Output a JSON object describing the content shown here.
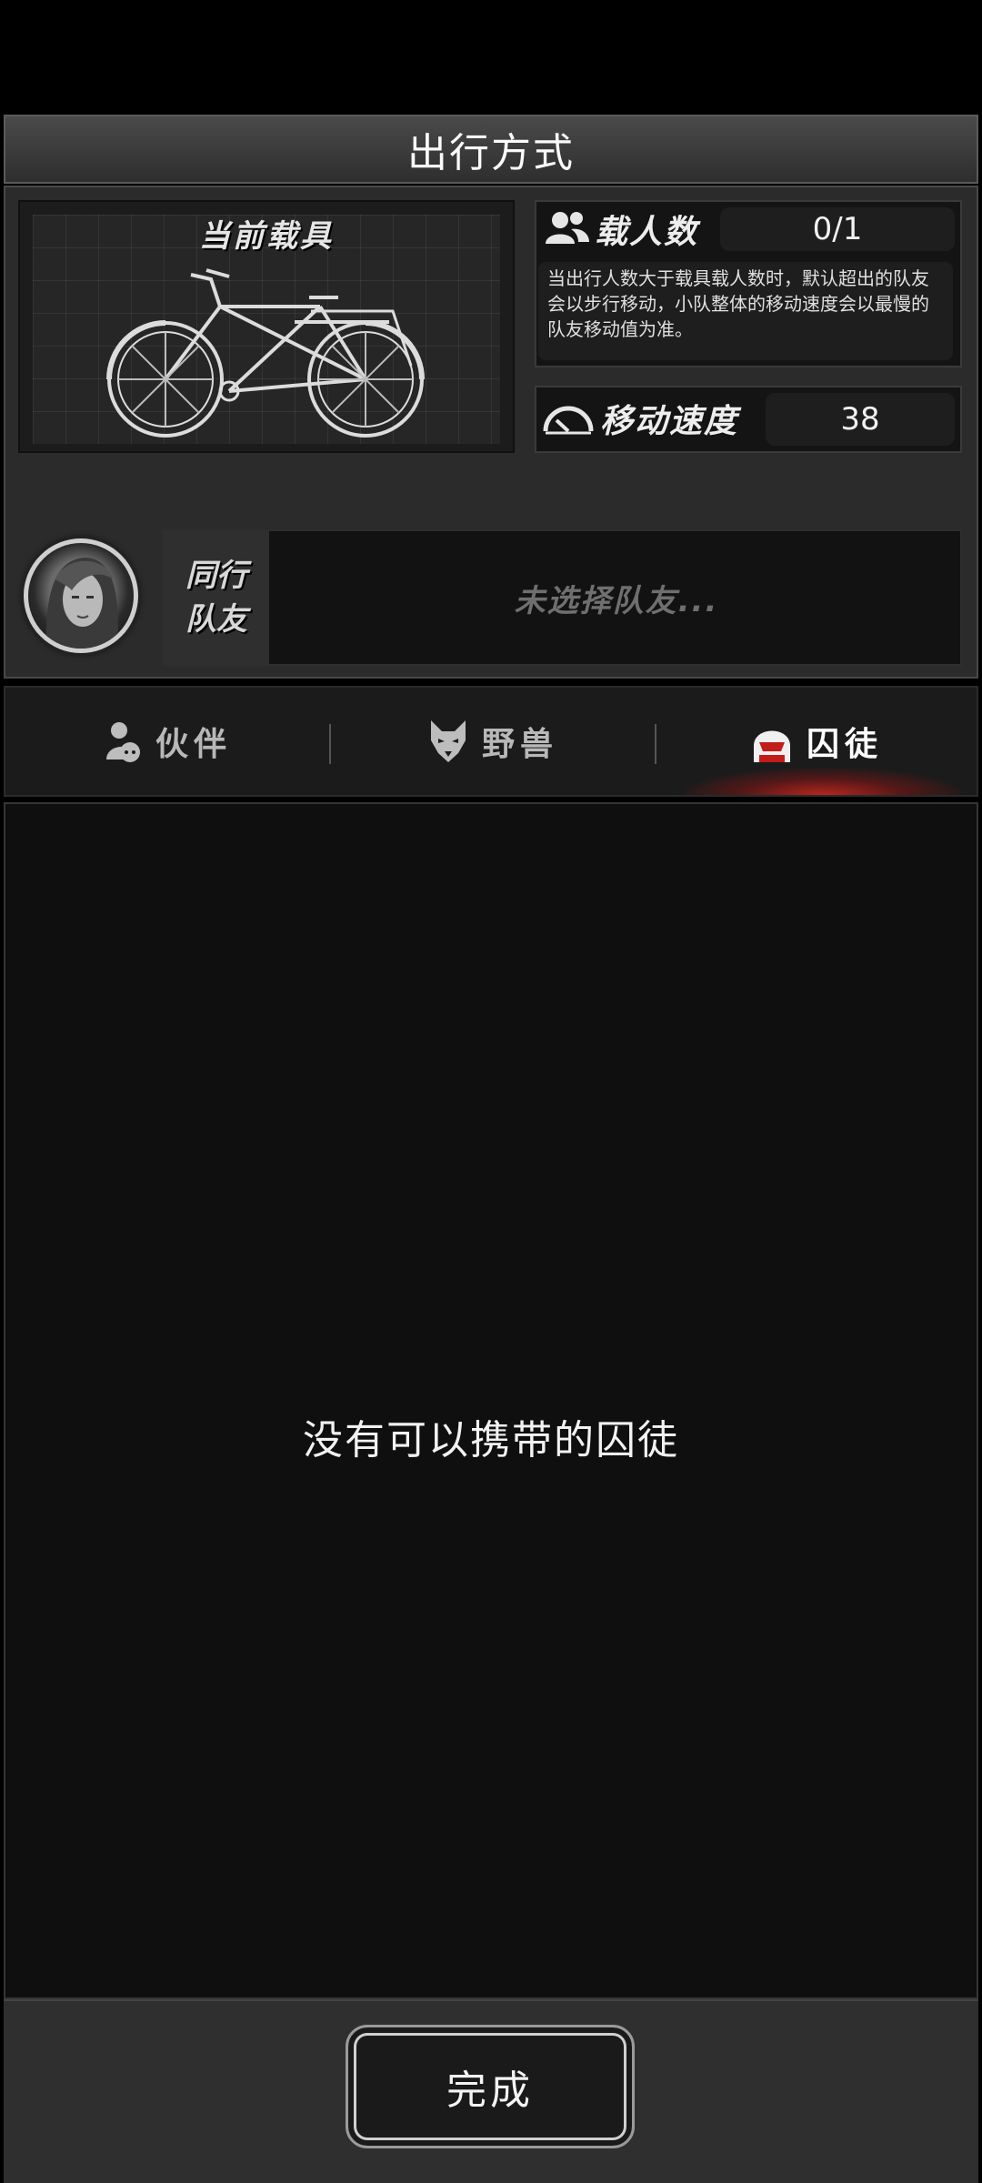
{
  "header": {
    "title": "出行方式"
  },
  "vehicle": {
    "title": "当前载具",
    "image_icon": "bicycle-icon"
  },
  "capacity": {
    "label": "载人数",
    "value": "0/1",
    "description": "当出行人数大于载具载人数时，默认超出的队友会以步行移动，小队整体的移动速度会以最慢的队友移动值为准。"
  },
  "speed": {
    "label": "移动速度",
    "value": "38"
  },
  "companion": {
    "label_line1": "同行",
    "label_line2": "队友",
    "placeholder": "未选择队友..."
  },
  "tabs": [
    {
      "label": "伙伴",
      "icon": "partner-icon",
      "active": false
    },
    {
      "label": "野兽",
      "icon": "wolf-icon",
      "active": false
    },
    {
      "label": "囚徒",
      "icon": "prisoner-icon",
      "active": true
    }
  ],
  "list": {
    "empty_message": "没有可以携带的囚徒"
  },
  "footer": {
    "done_label": "完成"
  },
  "colors": {
    "active_tab_glow": "#c0221d",
    "panel": "#2b2b2b",
    "background": "#0e0f0e"
  }
}
